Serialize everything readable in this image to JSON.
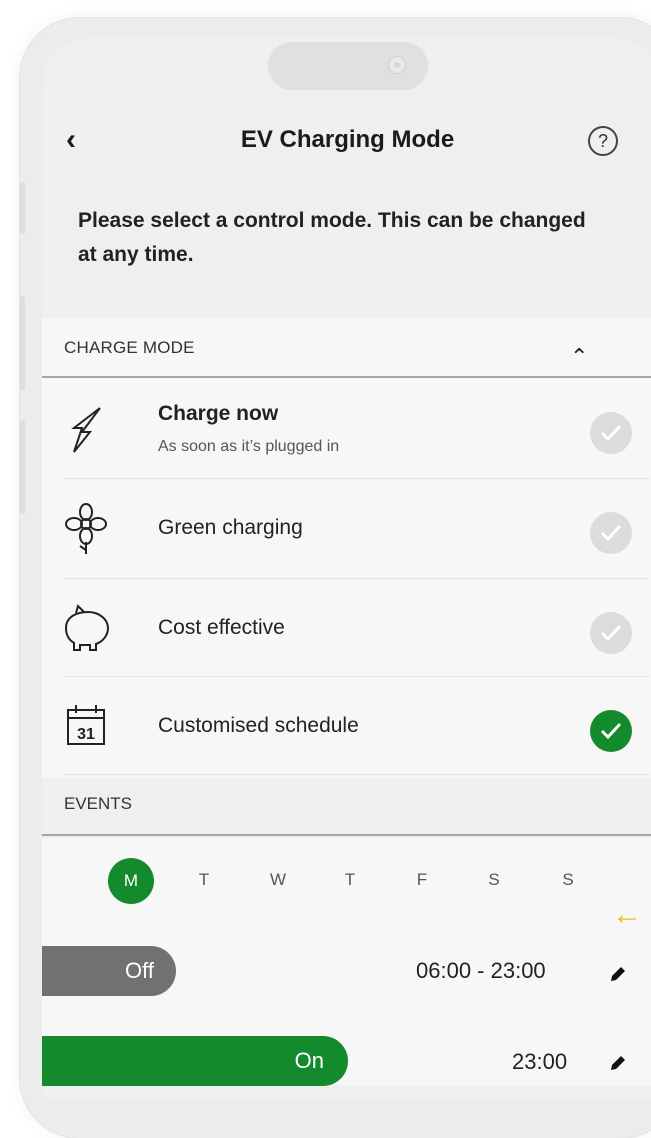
{
  "header": {
    "back_icon": "chevron-left-icon",
    "title": "EV Charging Mode",
    "help_icon": "question-circle-icon"
  },
  "intro": "Please select a control mode. This can be changed at any time.",
  "charge_mode": {
    "heading": "CHARGE MODE",
    "collapse_icon": "chevron-up-icon",
    "options": [
      {
        "icon": "lightning-bolt-icon",
        "label": "Charge now",
        "sub": "As soon as it’s plugged in",
        "selected": false
      },
      {
        "icon": "flower-icon",
        "label": "Green charging",
        "selected": false
      },
      {
        "icon": "piggy-bank-icon",
        "label": "Cost effective",
        "selected": false
      },
      {
        "icon": "calendar-icon",
        "calendar_day": "31",
        "label": "Customised schedule",
        "selected": true
      }
    ]
  },
  "events": {
    "heading": "EVENTS",
    "days": [
      "M",
      "T",
      "W",
      "T",
      "F",
      "S",
      "S"
    ],
    "selected_day": "M",
    "items": [
      {
        "state": "Off",
        "time": "06:00 - 23:00",
        "edit_icon": "pencil-icon"
      },
      {
        "state": "On",
        "time": "23:00",
        "edit_icon": "pencil-icon"
      }
    ]
  },
  "colors": {
    "accent_green": "#138a2c",
    "toggle_off": "#717171",
    "hint_arrow": "#f5b81c"
  }
}
